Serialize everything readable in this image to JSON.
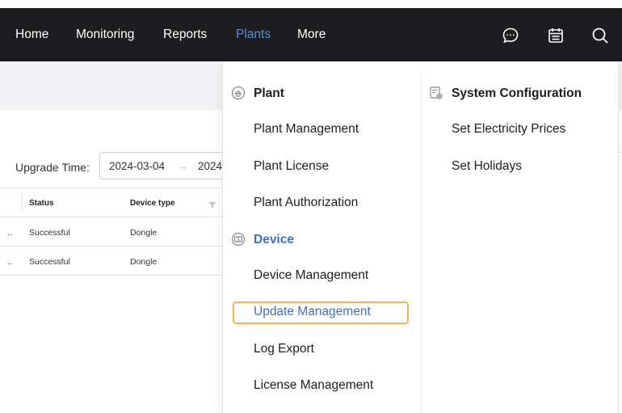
{
  "nav": {
    "items": [
      "Home",
      "Monitoring",
      "Reports",
      "Plants",
      "More"
    ],
    "icons": [
      "chat-icon",
      "calendar-icon",
      "search-icon"
    ]
  },
  "filter": {
    "label": "Upgrade Time",
    "colon": ":",
    "start_date": "2024-03-04",
    "arrow": "→",
    "end_date": "2024"
  },
  "table": {
    "headers": [
      "Status",
      "Device type"
    ],
    "rows": [
      {
        "prefix": "..",
        "status": "Successful",
        "device_type": "Dongle"
      },
      {
        "prefix": "..",
        "status": "Successful",
        "device_type": "Dongle"
      }
    ]
  },
  "menu": {
    "plant": {
      "title": "Plant",
      "items": [
        "Plant Management",
        "Plant License",
        "Plant Authorization"
      ]
    },
    "device": {
      "title": "Device",
      "items": [
        "Device Management",
        "Update Management",
        "Log Export",
        "License Management"
      ]
    },
    "system": {
      "title": "System Configuration",
      "items": [
        "Set Electricity Prices",
        "Set Holidays"
      ]
    }
  },
  "colors": {
    "nav_bg": "#1d1d1f",
    "active_nav": "#5a8fd8",
    "link_blue": "#3f6fc4",
    "highlight_border": "#f5b156"
  }
}
